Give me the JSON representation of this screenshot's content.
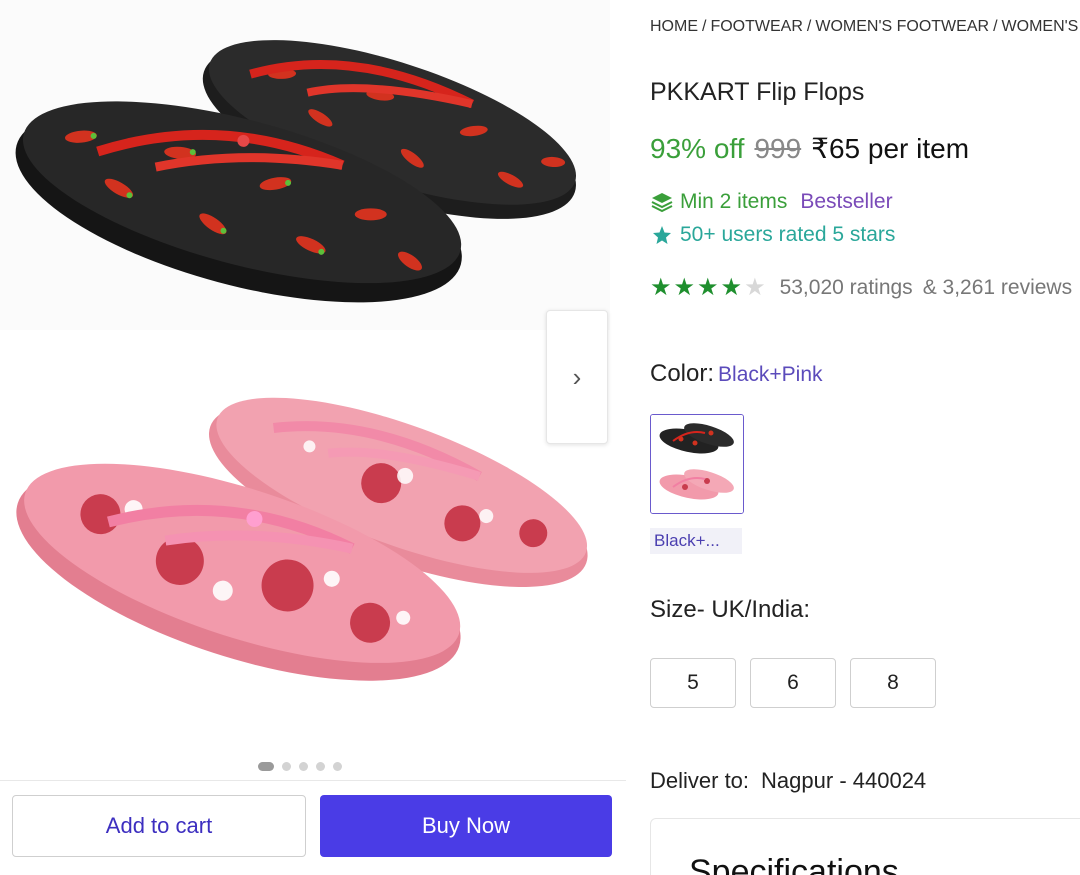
{
  "breadcrumb": [
    "HOME",
    "FOOTWEAR",
    "WOMEN'S FOOTWEAR",
    "WOMEN'S SLIPPERS"
  ],
  "product": {
    "title": "PKKART Flip Flops",
    "discount": "93% off",
    "mrp": "999",
    "price": "₹65 per item",
    "min_items": "Min 2 items",
    "bestseller": "Bestseller",
    "users_rated": "50+ users rated 5 stars",
    "rating_stars": 4,
    "ratings_count": "53,020 ratings",
    "reviews_count": "& 3,261 reviews"
  },
  "color": {
    "label": "Color:",
    "value": "Black+Pink",
    "swatch_label": "Black+..."
  },
  "size": {
    "label": "Size- UK/India:",
    "options": [
      "5",
      "6",
      "8"
    ]
  },
  "delivery": {
    "label": "Deliver to:",
    "location": "Nagpur - 440024"
  },
  "specifications": {
    "title": "Specifications"
  },
  "gallery": {
    "image_count": 5,
    "active_index": 0
  },
  "actions": {
    "add_to_cart": "Add to cart",
    "buy_now": "Buy Now"
  },
  "colors": {
    "accent": "#4a3ce6",
    "discount_green": "#3a9f3a",
    "bestseller_purple": "#7a4ab8",
    "rated_teal": "#2aa79a",
    "star_green": "#1f8f2e"
  },
  "icons": {
    "min_items": "stack-layers-icon",
    "users_rated": "sparkle-star-icon",
    "next": "chevron-right-icon"
  }
}
